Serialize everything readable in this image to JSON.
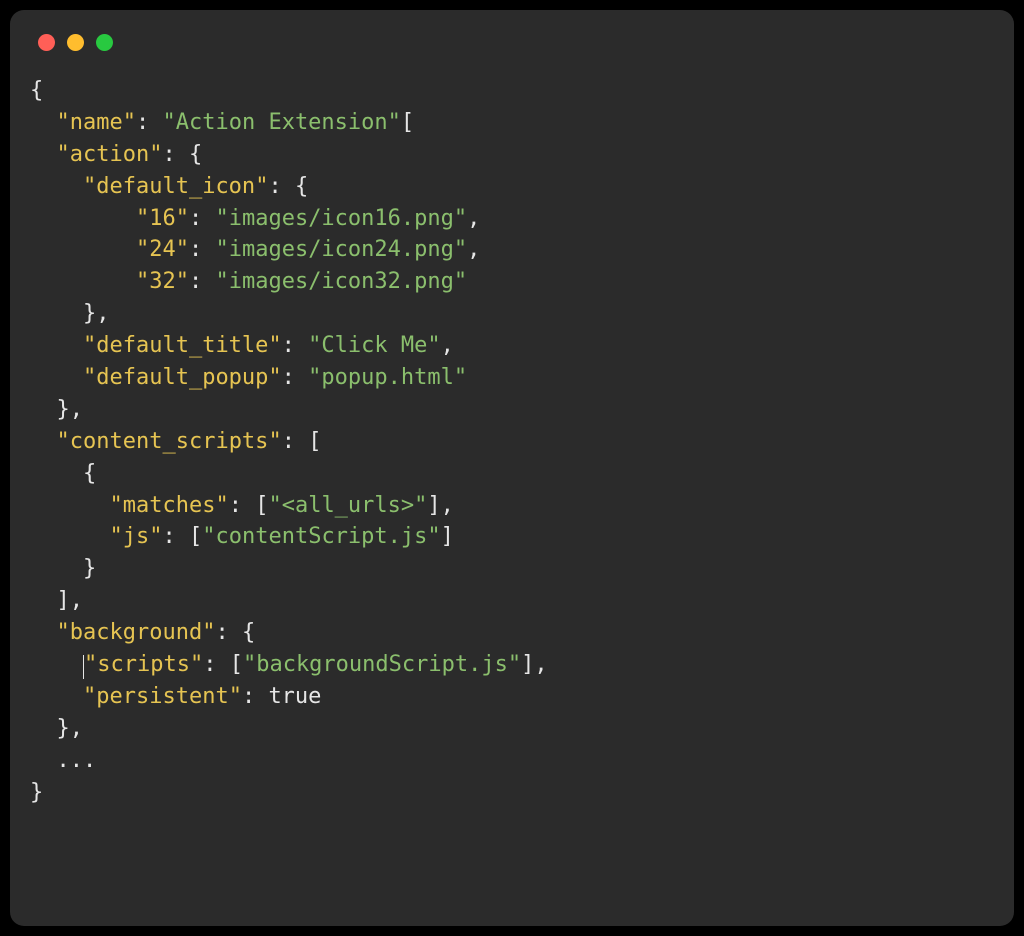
{
  "window": {
    "close_label": "close",
    "min_label": "minimize",
    "max_label": "maximize"
  },
  "code": {
    "punct": {
      "lbrace": "{",
      "rbrace": "}",
      "lbracket": "[",
      "rbracket": "]",
      "colon": ":",
      "comma": ",",
      "quote": "\"",
      "ellipsis": "..."
    },
    "keys": {
      "name": "name",
      "action": "action",
      "default_icon": "default_icon",
      "icon16": "16",
      "icon24": "24",
      "icon32": "32",
      "default_title": "default_title",
      "default_popup": "default_popup",
      "content_scripts": "content_scripts",
      "matches": "matches",
      "js": "js",
      "background": "background",
      "scripts": "scripts",
      "persistent": "persistent"
    },
    "values": {
      "name": "Action Extension",
      "icon16": "images/icon16.png",
      "icon24": "images/icon24.png",
      "icon32": "images/icon32.png",
      "default_title": "Click Me",
      "default_popup": "popup.html",
      "matches0": "<all_urls>",
      "js0": "contentScript.js",
      "scripts0": "backgroundScript.js",
      "persistent": "true"
    }
  }
}
